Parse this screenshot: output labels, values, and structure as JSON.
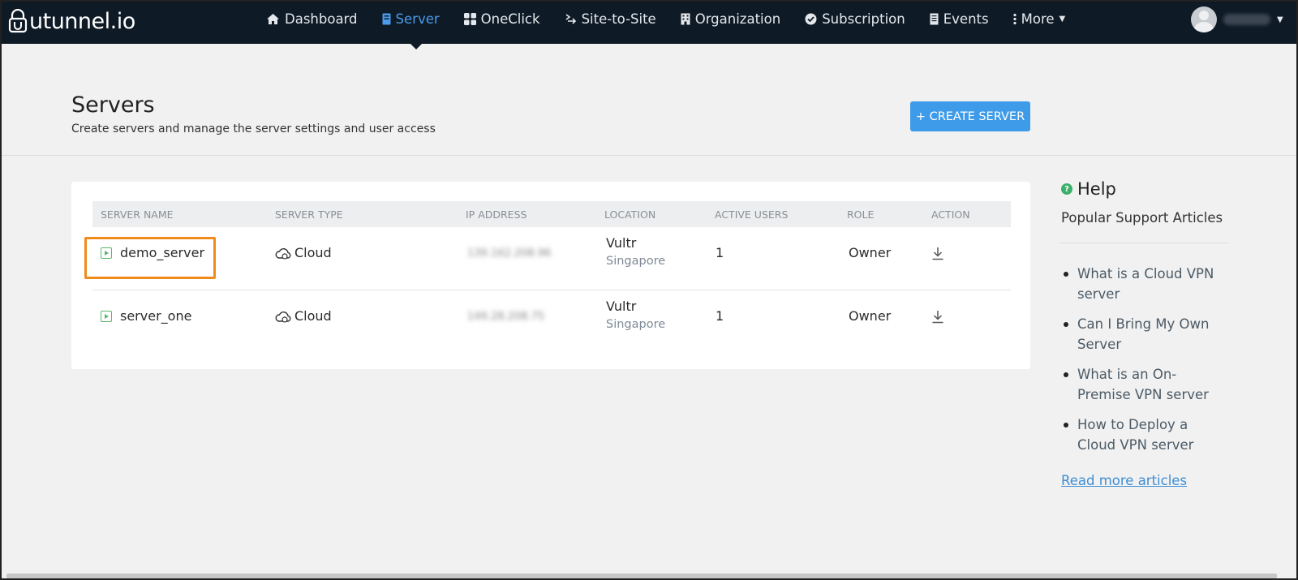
{
  "app": {
    "logo_text": "utunnel.io"
  },
  "nav": {
    "items": [
      {
        "label": "Dashboard",
        "icon": "home-icon"
      },
      {
        "label": "Server",
        "icon": "server-icon",
        "active": true
      },
      {
        "label": "OneClick",
        "icon": "apps-icon"
      },
      {
        "label": "Site-to-Site",
        "icon": "exchange-icon"
      },
      {
        "label": "Organization",
        "icon": "building-icon"
      },
      {
        "label": "Subscription",
        "icon": "check-circle-icon"
      },
      {
        "label": "Events",
        "icon": "list-icon"
      },
      {
        "label": "More",
        "icon": "more-icon"
      }
    ],
    "active_color": "#4a9bea",
    "bg_color": "#0e1a26"
  },
  "header": {
    "title": "Servers",
    "subtitle": "Create servers and manage the server settings and user access",
    "create_button": "+ CREATE SERVER",
    "button_color": "#3d9be9"
  },
  "table": {
    "columns": [
      "SERVER NAME",
      "SERVER TYPE",
      "IP ADDRESS",
      "LOCATION",
      "ACTIVE USERS",
      "ROLE",
      "ACTION"
    ],
    "rows": [
      {
        "name": "demo_server",
        "type": "Cloud",
        "ip": "139.162.208.96",
        "provider": "Vultr",
        "region": "Singapore",
        "active_users": "1",
        "role": "Owner",
        "highlighted": true
      },
      {
        "name": "server_one",
        "type": "Cloud",
        "ip": "149.28.208.75",
        "provider": "Vultr",
        "region": "Singapore",
        "active_users": "1",
        "role": "Owner"
      }
    ]
  },
  "help": {
    "title": "Help",
    "subtitle": "Popular Support Articles",
    "articles": [
      "What is a Cloud VPN server",
      "Can I Bring My Own Server",
      "What is an On-Premise VPN server",
      "How to Deploy a Cloud VPN server"
    ],
    "read_more": "Read more articles"
  },
  "colors": {
    "highlight": "#f08a1d",
    "status_green": "#5db66a"
  }
}
